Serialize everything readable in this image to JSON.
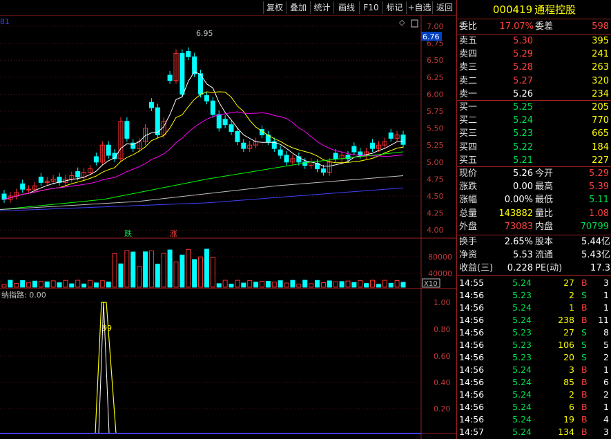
{
  "toolbar": {
    "buttons": [
      "复权",
      "叠加",
      "统计",
      "画线",
      "F10",
      "标记",
      "+自选",
      "返回"
    ]
  },
  "price_axis": [
    "7.00",
    "6.75",
    "6.50",
    "6.25",
    "6.00",
    "5.75",
    "5.50",
    "5.25",
    "5.00",
    "4.75",
    "4.50",
    "4.25",
    "4.00"
  ],
  "current_price_tag": "6.76",
  "high_label": "6.95",
  "partial_label_left": "81",
  "markers": {
    "die": "跌",
    "zhang": "涨"
  },
  "volume_axis": [
    "80000",
    "40000"
  ],
  "volume_unit": "X10",
  "indicator": {
    "title": "纳指路: 0.00",
    "axis": [
      "1.00",
      "0.80",
      "0.60",
      "0.40",
      "0.20"
    ],
    "peak_label": "99"
  },
  "stock": {
    "code": "000419",
    "name": "通程控股"
  },
  "weibi": {
    "label": "委比",
    "value": "17.07%",
    "label2": "委差",
    "value2": "598"
  },
  "asks": [
    {
      "label": "卖五",
      "price": "5.30",
      "vol": "395"
    },
    {
      "label": "卖四",
      "price": "5.29",
      "vol": "241"
    },
    {
      "label": "卖三",
      "price": "5.28",
      "vol": "263"
    },
    {
      "label": "卖二",
      "price": "5.27",
      "vol": "320"
    },
    {
      "label": "卖一",
      "price": "5.26",
      "vol": "234"
    }
  ],
  "bids": [
    {
      "label": "买一",
      "price": "5.25",
      "vol": "205"
    },
    {
      "label": "买二",
      "price": "5.24",
      "vol": "770"
    },
    {
      "label": "买三",
      "price": "5.23",
      "vol": "665"
    },
    {
      "label": "买四",
      "price": "5.22",
      "vol": "184"
    },
    {
      "label": "买五",
      "price": "5.21",
      "vol": "227"
    }
  ],
  "quote": [
    {
      "l1": "现价",
      "v1": "5.26",
      "l2": "今开",
      "v2": "5.29"
    },
    {
      "l1": "涨跌",
      "v1": "0.00",
      "l2": "最高",
      "v2": "5.39"
    },
    {
      "l1": "涨幅",
      "v1": "0.00%",
      "l2": "最低",
      "v2": "5.11"
    },
    {
      "l1": "总量",
      "v1": "143882",
      "l2": "量比",
      "v2": "1.08"
    },
    {
      "l1": "外盘",
      "v1": "73083",
      "l2": "内盘",
      "v2": "70799"
    }
  ],
  "stats": [
    {
      "l1": "换手",
      "v1": "2.65%",
      "l2": "股本",
      "v2": "5.44亿"
    },
    {
      "l1": "净资",
      "v1": "5.53",
      "l2": "流通",
      "v2": "5.43亿"
    },
    {
      "l1": "收益(三)",
      "v1": "0.228",
      "l2": "PE(动)",
      "v2": "17.3"
    }
  ],
  "ticks": [
    {
      "time": "14:55",
      "price": "5.24",
      "vol": "27",
      "side": "B",
      "n": "3"
    },
    {
      "time": "14:56",
      "price": "5.23",
      "vol": "2",
      "side": "S",
      "n": "1"
    },
    {
      "time": "14:56",
      "price": "5.24",
      "vol": "1",
      "side": "B",
      "n": "1"
    },
    {
      "time": "14:56",
      "price": "5.24",
      "vol": "238",
      "side": "B",
      "n": "11"
    },
    {
      "time": "14:56",
      "price": "5.23",
      "vol": "27",
      "side": "S",
      "n": "8"
    },
    {
      "time": "14:56",
      "price": "5.23",
      "vol": "106",
      "side": "S",
      "n": "5"
    },
    {
      "time": "14:56",
      "price": "5.23",
      "vol": "20",
      "side": "S",
      "n": "2"
    },
    {
      "time": "14:56",
      "price": "5.24",
      "vol": "3",
      "side": "B",
      "n": "1"
    },
    {
      "time": "14:56",
      "price": "5.24",
      "vol": "85",
      "side": "B",
      "n": "6"
    },
    {
      "time": "14:56",
      "price": "5.24",
      "vol": "2",
      "side": "B",
      "n": "2"
    },
    {
      "time": "14:56",
      "price": "5.24",
      "vol": "6",
      "side": "B",
      "n": "1"
    },
    {
      "time": "14:56",
      "price": "5.24",
      "vol": "19",
      "side": "B",
      "n": "4"
    },
    {
      "time": "14:57",
      "price": "5.24",
      "vol": "134",
      "side": "B",
      "n": "3"
    }
  ],
  "colors": {
    "up": "#ff3030",
    "down": "#00ffff",
    "grid": "#a02020",
    "ma5": "#ffffff",
    "ma10": "#ffff00",
    "ma20": "#ff00ff",
    "ma60": "#00ff00",
    "ma120": "#c0c0c0",
    "ma250": "#4040ff"
  }
}
